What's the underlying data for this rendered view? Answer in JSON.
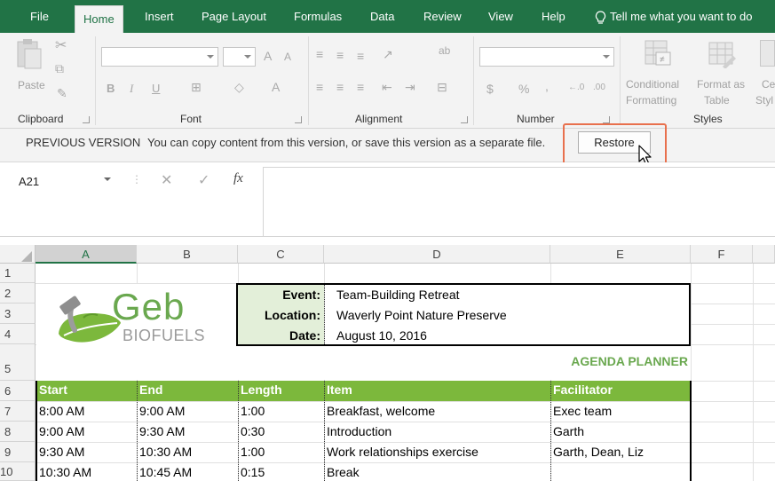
{
  "menu": {
    "tabs": [
      "File",
      "Home",
      "Insert",
      "Page Layout",
      "Formulas",
      "Data",
      "Review",
      "View",
      "Help"
    ],
    "tell_me": "Tell me what you want to do"
  },
  "ribbon": {
    "paste": "Paste",
    "groups": {
      "clipboard": "Clipboard",
      "font": "Font",
      "alignment": "Alignment",
      "number": "Number",
      "styles": "Styles"
    },
    "font_buttons": {
      "bold": "B",
      "italic": "I",
      "underline": "U",
      "font_color": "A",
      "grow": "A",
      "shrink": "A"
    },
    "number_buttons": {
      "currency": "$",
      "percent": "%",
      "comma": ","
    },
    "conditional_formatting": [
      "Conditional",
      "Formatting"
    ],
    "format_as_table": [
      "Format as",
      "Table"
    ],
    "cell_styles": [
      "Ce",
      "Styl"
    ]
  },
  "version_bar": {
    "title": "PREVIOUS VERSION",
    "message": "You can copy content from this version, or save this version as a separate file.",
    "restore": "Restore"
  },
  "formula_bar": {
    "name_box": "A21",
    "fx": "fx",
    "value": ""
  },
  "sheet": {
    "columns": [
      "A",
      "B",
      "C",
      "D",
      "E",
      "F"
    ],
    "rows": [
      "1",
      "2",
      "3",
      "4",
      "5",
      "6",
      "7",
      "8",
      "9",
      "10"
    ],
    "logo": {
      "name": "Geb",
      "sub": "BIOFUELS"
    },
    "info": [
      {
        "label": "Event:",
        "value": "Team-Building Retreat"
      },
      {
        "label": "Location:",
        "value": "Waverly Point Nature Preserve"
      },
      {
        "label": "Date:",
        "value": "August 10, 2016"
      }
    ],
    "title": "AGENDA PLANNER",
    "headers": [
      "Start",
      "End",
      "Length",
      "Item",
      "Facilitator"
    ],
    "data": [
      [
        "8:00 AM",
        "9:00 AM",
        "1:00",
        "Breakfast, welcome",
        "Exec team"
      ],
      [
        "9:00 AM",
        "9:30 AM",
        "0:30",
        "Introduction",
        "Garth"
      ],
      [
        "9:30 AM",
        "10:30 AM",
        "1:00",
        "Work relationships exercise",
        "Garth, Dean, Liz"
      ],
      [
        "10:30 AM",
        "10:45 AM",
        "0:15",
        "Break",
        ""
      ]
    ]
  },
  "colors": {
    "excel_green": "#217346",
    "header_green": "#7cb83c",
    "info_bg": "#e3efd9",
    "title_green": "#6aa84f",
    "highlight": "#e8704d"
  }
}
